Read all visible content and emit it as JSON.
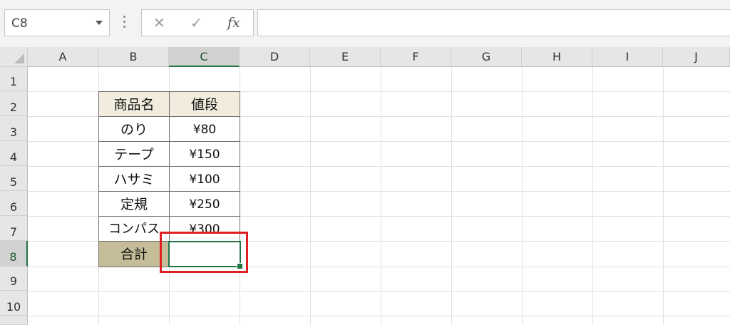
{
  "formula_bar": {
    "name_box": "C8",
    "cancel_icon": "✕",
    "enter_icon": "✓",
    "fx_label": "fx",
    "formula_value": ""
  },
  "columns": [
    "A",
    "B",
    "C",
    "D",
    "E",
    "F",
    "G",
    "H",
    "I",
    "J"
  ],
  "rows": [
    "1",
    "2",
    "3",
    "4",
    "5",
    "6",
    "7",
    "8",
    "9",
    "10"
  ],
  "selected": {
    "column": "C",
    "row": "8"
  },
  "table": {
    "header": [
      "商品名",
      "値段"
    ],
    "rows": [
      [
        "のり",
        "¥80"
      ],
      [
        "テープ",
        "¥150"
      ],
      [
        "ハサミ",
        "¥100"
      ],
      [
        "定規",
        "¥250"
      ],
      [
        "コンパス",
        "¥300"
      ]
    ],
    "total_label": "合計",
    "total_value": ""
  },
  "colors": {
    "header_fill": "#f1ecde",
    "total_fill": "#c4bd97",
    "selection_green": "#217346",
    "highlight_red": "#e02020"
  }
}
